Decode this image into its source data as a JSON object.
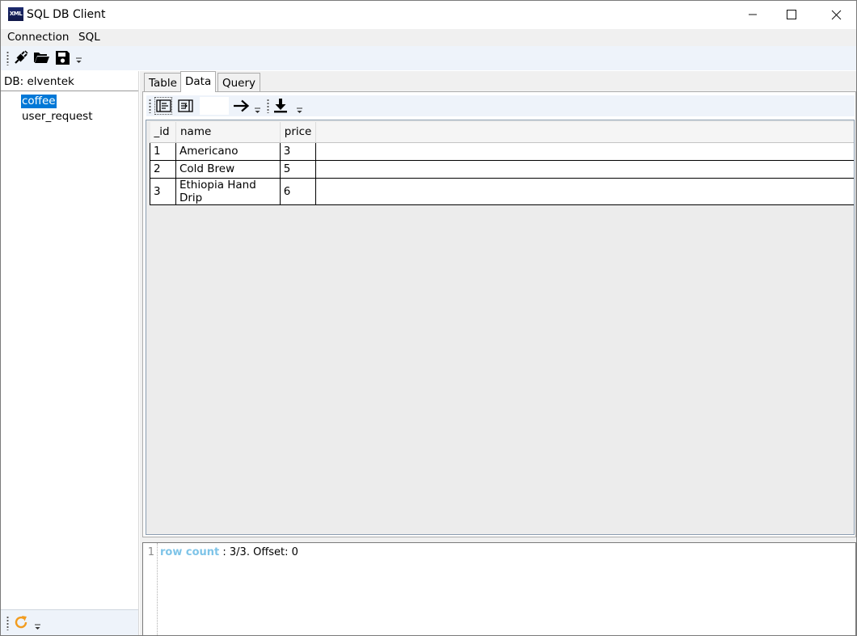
{
  "window": {
    "title": "SQL DB Client",
    "app_icon_text": "XML",
    "minimize_symbol": "—",
    "maximize_symbol": "☐",
    "close_symbol": "✕"
  },
  "menu": {
    "items": [
      "Connection",
      "SQL"
    ]
  },
  "toolbar": {
    "icons": [
      "connect-plug-icon",
      "open-folder-icon",
      "save-disk-icon"
    ],
    "overflow": "⌄"
  },
  "left_panel": {
    "db_label": "DB: elventek",
    "tables": [
      "coffee",
      "user_request"
    ],
    "selected": "coffee",
    "bottom_icons": [
      "refresh-icon"
    ]
  },
  "tabs": {
    "items": [
      "Table",
      "Data",
      "Query"
    ],
    "active": "Data"
  },
  "data_toolbar": {
    "icons": [
      "next-page-icon",
      "prev-page-icon",
      "go-arrow-icon",
      "download-icon"
    ],
    "offset_value": ""
  },
  "grid": {
    "columns": [
      "_id",
      "name",
      "price"
    ],
    "rows": [
      [
        "1",
        "Americano",
        "3"
      ],
      [
        "2",
        "Cold Brew",
        "5"
      ],
      [
        "3",
        "Ethiopia Hand Drip",
        "6"
      ]
    ]
  },
  "log": {
    "line_number": "1",
    "key": "row count",
    "text": " : 3/3. Offset: 0"
  },
  "colors": {
    "selection": "#0078d7",
    "toolbar_bg": "#eef3fa",
    "log_key": "#7ec4e8"
  }
}
